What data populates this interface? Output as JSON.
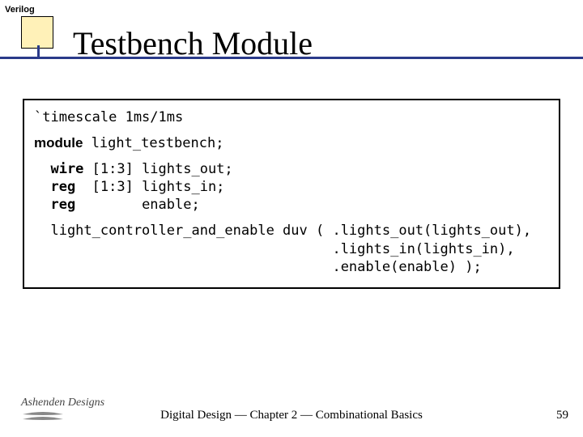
{
  "tag": "Verilog",
  "title": "Testbench Module",
  "code": {
    "l1": "`timescale 1ms/1ms",
    "l2a": "module",
    "l2b": " light_testbench;",
    "l3a": "  wire",
    "l3b": " [1:3] lights_out;",
    "l4a": "  reg",
    "l4b": "  [1:3] lights_in;",
    "l5a": "  reg",
    "l5b": "        enable;",
    "l6": "  light_controller_and_enable duv ( .lights_out(lights_out),",
    "l7": "                                    .lights_in(lights_in),",
    "l8": "                                    .enable(enable) );"
  },
  "logo_text": "Ashenden Designs",
  "footer": "Digital Design — Chapter 2 — Combinational Basics",
  "page": "59"
}
